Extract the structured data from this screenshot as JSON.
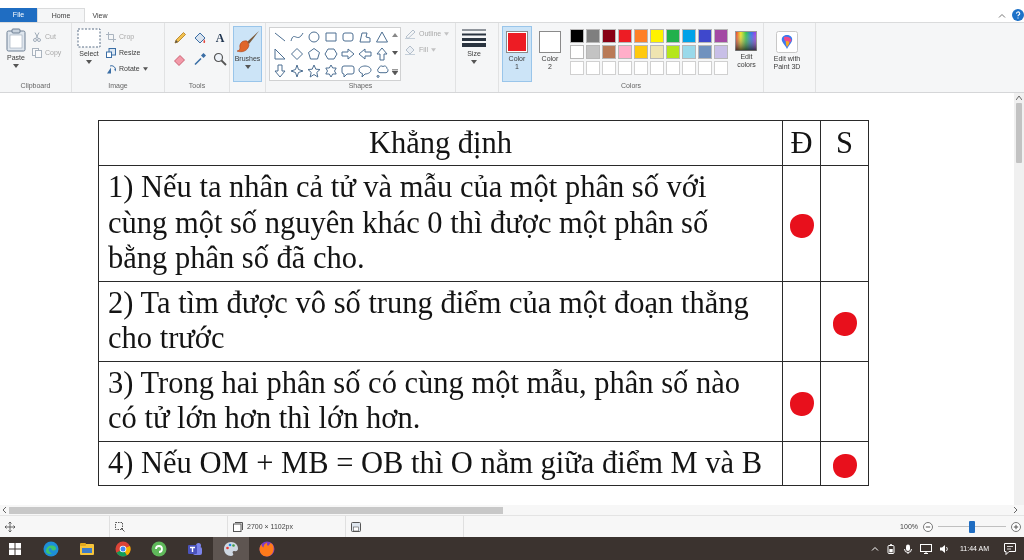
{
  "ribbon_tabs": {
    "file_button": "File",
    "tabs": [
      {
        "label": "Home",
        "selected": true
      },
      {
        "label": "View",
        "selected": false
      }
    ]
  },
  "ribbon": {
    "clipboard": {
      "title": "Clipboard",
      "paste": "Paste",
      "actions": [
        {
          "label": "Cut",
          "disabled": true
        },
        {
          "label": "Copy",
          "disabled": true
        }
      ]
    },
    "image": {
      "title": "Image",
      "select": "Select",
      "actions": [
        {
          "label": "Crop",
          "disabled": true,
          "dropdown": false
        },
        {
          "label": "Resize",
          "disabled": false,
          "dropdown": false
        },
        {
          "label": "Rotate",
          "disabled": false,
          "dropdown": true
        }
      ]
    },
    "tools": {
      "title": "Tools",
      "text_tool": "A"
    },
    "brushes": {
      "label": "Brushes",
      "selected": true
    },
    "shapes": {
      "title": "Shapes",
      "options": [
        {
          "label": "Outline",
          "disabled": true
        },
        {
          "label": "Fill",
          "disabled": true
        }
      ]
    },
    "size": {
      "label": "Size"
    },
    "colors": {
      "title": "Colors",
      "slots": [
        {
          "label": "Color 1",
          "color": "#ed1c24",
          "selected": true
        },
        {
          "label": "Color 2",
          "color": "#ffffff",
          "selected": false
        }
      ],
      "palette": [
        {
          "color": "#000000"
        },
        {
          "color": "#7f7f7f"
        },
        {
          "color": "#880015"
        },
        {
          "color": "#ed1c24"
        },
        {
          "color": "#ff7f27"
        },
        {
          "color": "#fff200"
        },
        {
          "color": "#22b14c"
        },
        {
          "color": "#00a2e8"
        },
        {
          "color": "#3f48cc"
        },
        {
          "color": "#a349a4"
        },
        {
          "color": "#ffffff"
        },
        {
          "color": "#c3c3c3"
        },
        {
          "color": "#b97a57"
        },
        {
          "color": "#ffaec9"
        },
        {
          "color": "#ffc90e"
        },
        {
          "color": "#efe4b0"
        },
        {
          "color": "#b5e61d"
        },
        {
          "color": "#99d9ea"
        },
        {
          "color": "#7092be"
        },
        {
          "color": "#c8bfe7"
        }
      ],
      "edit_colors": "Edit colors"
    },
    "paint3d": {
      "label": "Edit with Paint 3D"
    }
  },
  "table": {
    "columns": [
      "Khẳng định",
      "Đ",
      "S"
    ],
    "rows": [
      {
        "text": "1) Nếu ta nhân cả tử và mẫu của một phân số với cùng một số nguyên khác 0 thì được một phân số bằng phân số đã cho.",
        "d_marked": true,
        "s_marked": false
      },
      {
        "text": "2) Ta tìm được vô số trung điểm của một đoạn thẳng cho trước",
        "d_marked": false,
        "s_marked": true
      },
      {
        "text": "3) Trong hai phân số có cùng một mẫu, phân số nào có tử lớn hơn thì lớn hơn.",
        "d_marked": true,
        "s_marked": false
      },
      {
        "text": "4) Nếu OM + MB = OB thì O nằm giữa điểm M và B",
        "d_marked": false,
        "s_marked": true
      }
    ]
  },
  "status_bar": {
    "image_size": "2700 × 1102px",
    "zoom": "100%",
    "zoom_slider": {
      "level": 0.5
    }
  },
  "taskbar": {
    "apps": [
      {
        "selected": false
      },
      {
        "selected": false
      },
      {
        "selected": false
      },
      {
        "selected": false
      },
      {
        "selected": false
      },
      {
        "selected": true
      },
      {
        "selected": false
      }
    ],
    "clock": "11:44 AM"
  }
}
